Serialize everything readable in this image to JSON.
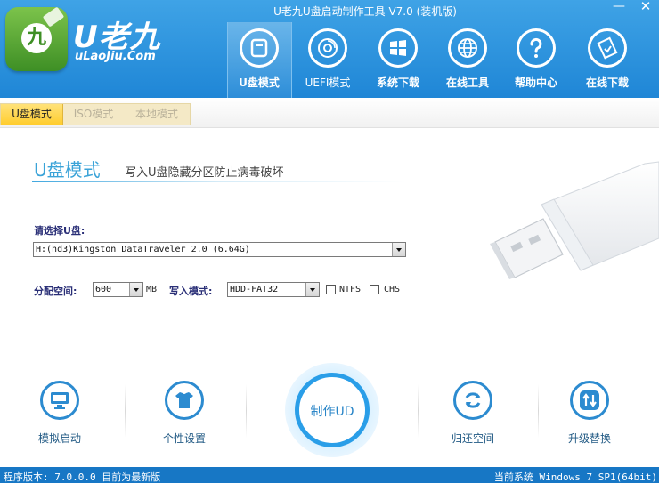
{
  "window": {
    "title": "U老九U盘启动制作工具 V7.0 (装机版)",
    "minimize_symbol": "—",
    "close_symbol": "✕"
  },
  "logo": {
    "main": "U老九",
    "sub": "uLaoJiu.Com",
    "glyph": "九"
  },
  "nav": [
    {
      "label": "U盘模式",
      "icon": "usb-drive-icon",
      "active": true
    },
    {
      "label": "UEFI模式",
      "icon": "disc-icon",
      "active": false
    },
    {
      "label": "系统下载",
      "icon": "windows-logo-icon",
      "active": false
    },
    {
      "label": "在线工具",
      "icon": "globe-icon",
      "active": false
    },
    {
      "label": "帮助中心",
      "icon": "question-icon",
      "active": false
    },
    {
      "label": "在线下载",
      "icon": "download-icon",
      "active": false
    }
  ],
  "tabs": [
    {
      "label": "U盘模式",
      "active": true
    },
    {
      "label": "ISO模式",
      "active": false
    },
    {
      "label": "本地模式",
      "active": false
    }
  ],
  "section": {
    "title": "U盘模式",
    "description": "写入U盘隐藏分区防止病毒破坏"
  },
  "form": {
    "select_label": "请选择U盘:",
    "selected_drive": "H:(hd3)Kingston DataTraveler 2.0 (6.64G)",
    "alloc_label": "分配空间:",
    "alloc_value": "600",
    "alloc_unit": "MB",
    "write_mode_label": "写入模式:",
    "write_mode_value": "HDD-FAT32",
    "ntfs_label": "NTFS",
    "ntfs_checked": false,
    "chs_label": "CHS",
    "chs_checked": false
  },
  "tools": {
    "simulate": "模拟启动",
    "personalize": "个性设置",
    "make": "制作UD",
    "restore": "归还空间",
    "upgrade": "升级替换"
  },
  "status": {
    "version": "程序版本: 7.0.0.0  目前为最新版",
    "system": "当前系统 Windows 7 SP1(64bit)"
  },
  "colors": {
    "header": "#1f86d6",
    "accent": "#2a9ee8",
    "tab_active": "#ffcd2e",
    "status_bar": "#1777c5"
  }
}
